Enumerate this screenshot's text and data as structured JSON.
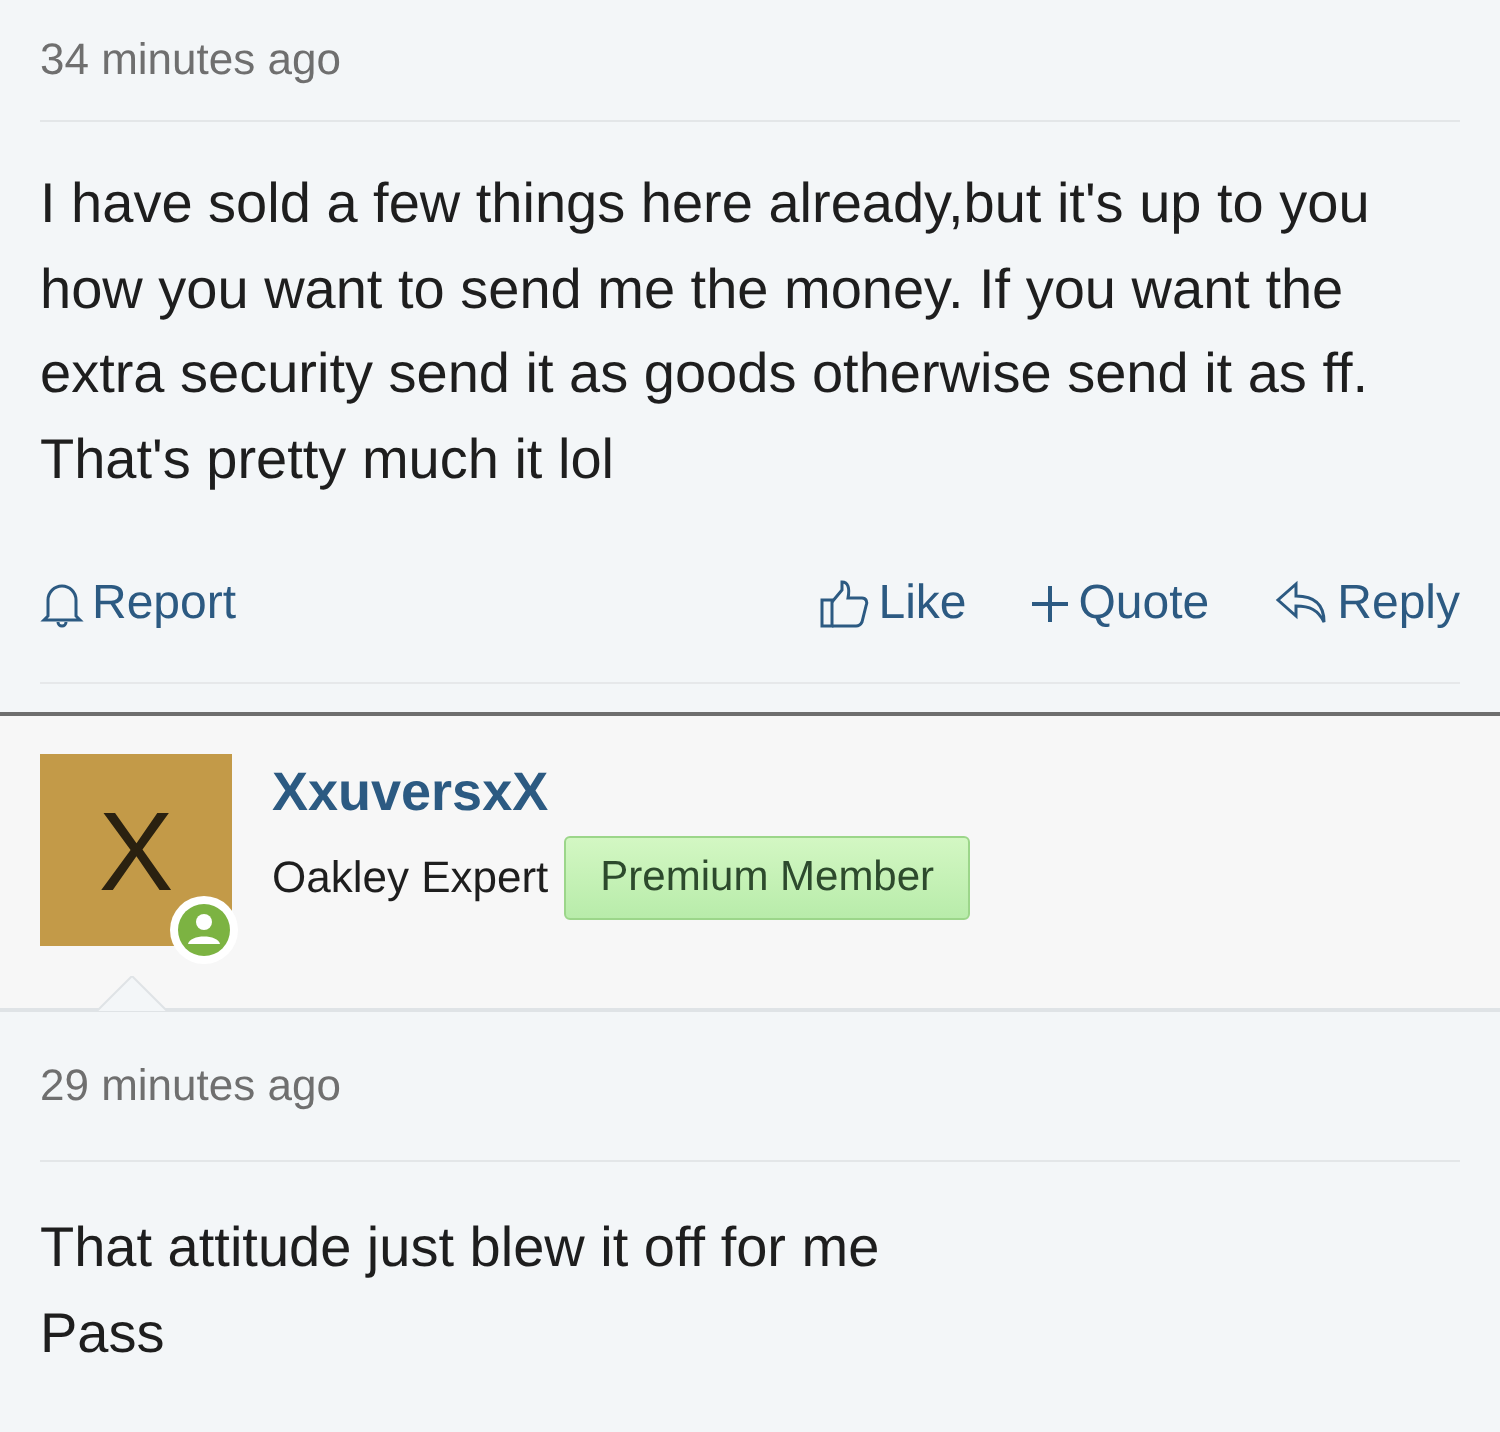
{
  "posts": [
    {
      "time": "34 minutes ago",
      "body": [
        "I have sold a few things here already,but it's up to you how you want to send me the money. If you want the extra security send it as goods otherwise send it as ff. That's pretty much it lol"
      ],
      "actions": {
        "report": "Report",
        "like": "Like",
        "quote": "Quote",
        "reply": "Reply"
      }
    },
    {
      "author": {
        "avatar_letter": "X",
        "name": "XxuversxX",
        "title": "Oakley Expert",
        "badge": "Premium Member"
      },
      "time": "29 minutes ago",
      "body": [
        "That attitude just blew it off for me",
        "Pass"
      ]
    }
  ]
}
